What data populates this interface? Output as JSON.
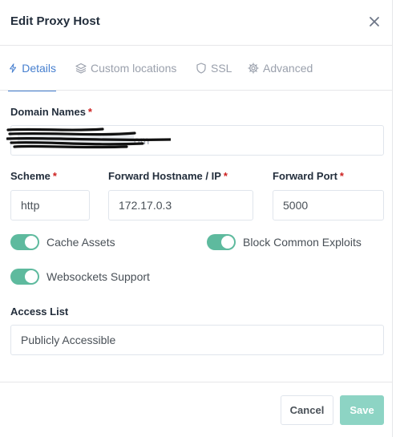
{
  "modal": {
    "title": "Edit Proxy Host",
    "close_icon": "close-icon"
  },
  "tabs": [
    {
      "label": "Details",
      "icon": "bolt-icon",
      "active": true
    },
    {
      "label": "Custom locations",
      "icon": "layers-icon",
      "active": false
    },
    {
      "label": "SSL",
      "icon": "shield-icon",
      "active": false
    },
    {
      "label": "Advanced",
      "icon": "gear-icon",
      "active": false
    }
  ],
  "form": {
    "domain_names": {
      "label": "Domain Names",
      "required": "*",
      "value": ".com"
    },
    "scheme": {
      "label": "Scheme",
      "required": "*",
      "value": "http"
    },
    "forward_hostname": {
      "label": "Forward Hostname / IP",
      "required": "*",
      "value": "172.17.0.3"
    },
    "forward_port": {
      "label": "Forward Port",
      "required": "*",
      "value": "5000"
    },
    "cache_assets": {
      "label": "Cache Assets",
      "on": true
    },
    "block_exploits": {
      "label": "Block Common Exploits",
      "on": true
    },
    "websockets": {
      "label": "Websockets Support",
      "on": true
    },
    "access_list": {
      "label": "Access List",
      "value": "Publicly Accessible"
    }
  },
  "footer": {
    "cancel_label": "Cancel",
    "save_label": "Save"
  },
  "colors": {
    "accent": "#467fcf",
    "toggle_on": "#5eba9e",
    "save_button": "#8dd4c4",
    "required": "#cd201f"
  }
}
